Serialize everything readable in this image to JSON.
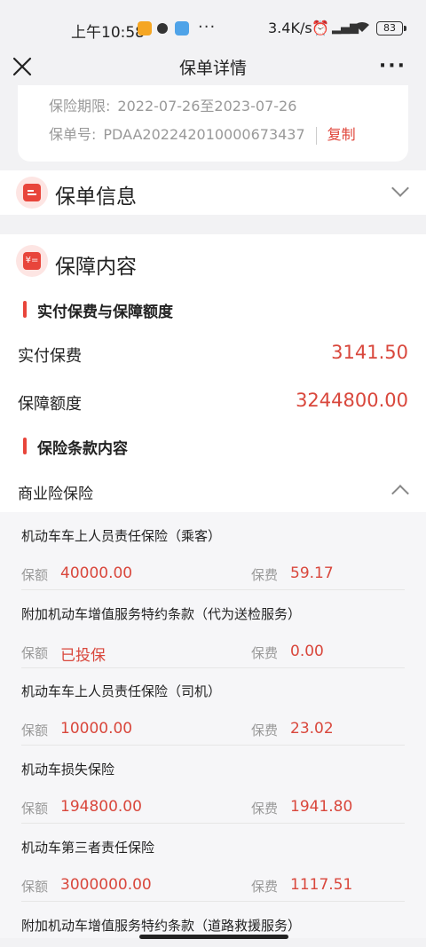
{
  "status_bar": {
    "time": "上午10:58",
    "more": "···",
    "net_speed": "3.4K/s",
    "battery": "83"
  },
  "nav": {
    "title": "保单详情",
    "more": "···"
  },
  "policy_card": {
    "period_label": "保险期限:",
    "period_value": "2022-07-26至2023-07-26",
    "number_label": "保单号:",
    "number_value": "PDAA202242010000673437",
    "copy_label": "复制"
  },
  "policy_info": {
    "icon_text": "",
    "title": "保单信息"
  },
  "coverage": {
    "icon_text": "¥=",
    "title": "保障内容",
    "premium_heading": "实付保费与保障额度",
    "paid_premium_label": "实付保费",
    "paid_premium_value": "3141.50",
    "coverage_amount_label": "保障额度",
    "coverage_amount_value": "3244800.00",
    "clauses_heading": "保险条款内容",
    "commercial_label": "商业险保险"
  },
  "clauses": [
    {
      "name": "机动车车上人员责任保险（乘客）",
      "amount_label": "保额",
      "amount": "40000.00",
      "premium_label": "保费",
      "premium": "59.17"
    },
    {
      "name": "附加机动车增值服务特约条款（代为送检服务）",
      "amount_label": "保额",
      "amount": "已投保",
      "premium_label": "保费",
      "premium": "0.00"
    },
    {
      "name": "机动车车上人员责任保险（司机）",
      "amount_label": "保额",
      "amount": "10000.00",
      "premium_label": "保费",
      "premium": "23.02"
    },
    {
      "name": "机动车损失保险",
      "amount_label": "保额",
      "amount": "194800.00",
      "premium_label": "保费",
      "premium": "1941.80"
    },
    {
      "name": "机动车第三者责任保险",
      "amount_label": "保额",
      "amount": "3000000.00",
      "premium_label": "保费",
      "premium": "1117.51"
    },
    {
      "name": "附加机动车增值服务特约条款（道路救援服务）",
      "amount_label": "",
      "amount": "",
      "premium_label": "",
      "premium": ""
    }
  ],
  "colors": {
    "accent": "#e8453b",
    "value_red": "#d9473c",
    "background": "#f2f2f4"
  }
}
